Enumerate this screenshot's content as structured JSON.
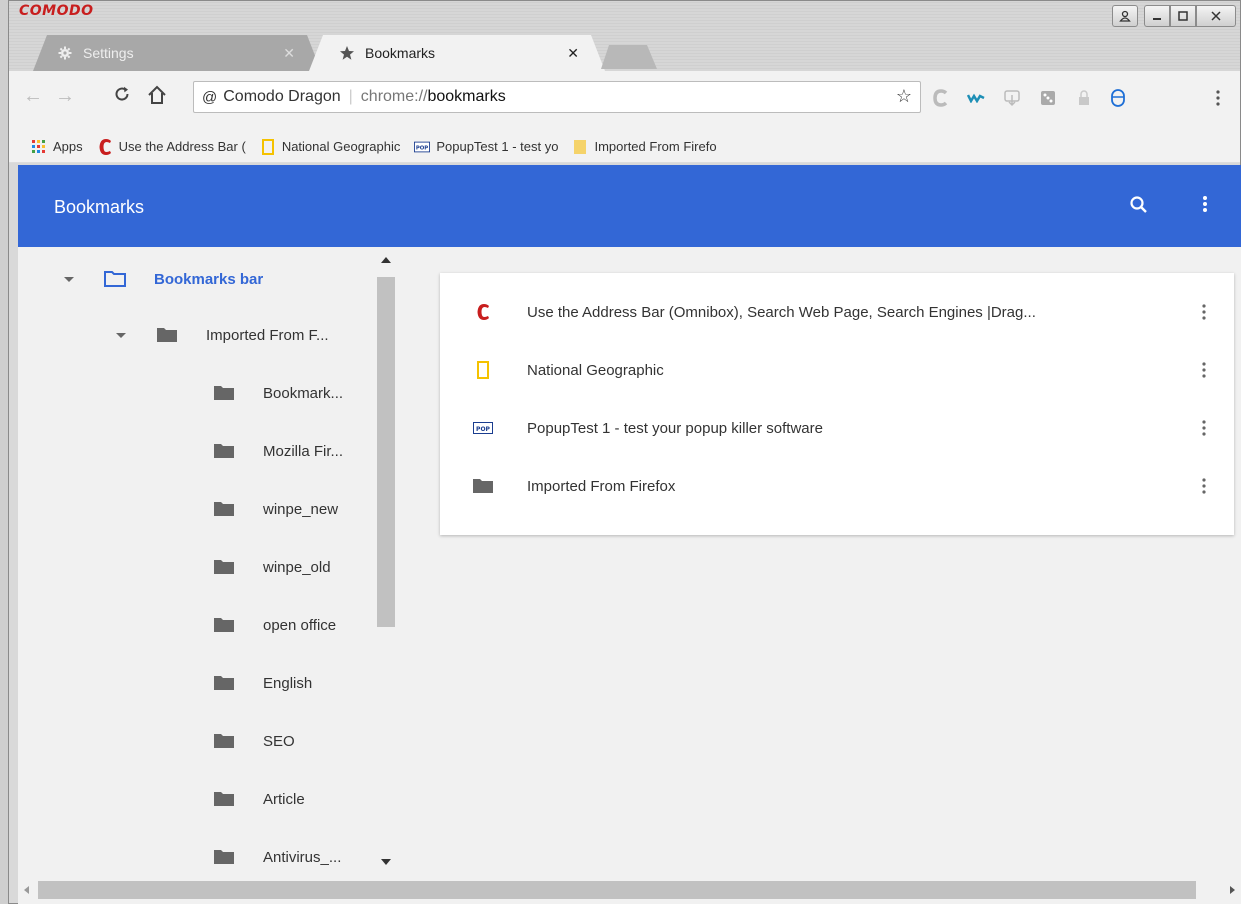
{
  "brand": "COMODO",
  "tabs": [
    {
      "label": "Settings",
      "icon": "gear-icon"
    },
    {
      "label": "Bookmarks",
      "icon": "star-icon"
    }
  ],
  "omnibox": {
    "site_label": "Comodo Dragon",
    "url_scheme": "chrome://",
    "url_host": "bookmarks"
  },
  "bookmarks_bar": {
    "items": [
      {
        "label": "Apps",
        "icon": "apps-grid-icon"
      },
      {
        "label": "Use the Address Bar (",
        "icon": "comodo-c-icon"
      },
      {
        "label": "National Geographic",
        "icon": "natgeo-icon"
      },
      {
        "label": "PopupTest 1 - test yo",
        "icon": "pop-icon"
      },
      {
        "label": "Imported From Firefo",
        "icon": "folder-yellow-icon"
      }
    ]
  },
  "header": {
    "title": "Bookmarks"
  },
  "tree": {
    "root": "Bookmarks bar",
    "child": "Imported From F...",
    "folders": [
      "Bookmark...",
      "Mozilla Fir...",
      "winpe_new",
      "winpe_old",
      "open office",
      "English",
      "SEO",
      "Article",
      "Antivirus_..."
    ]
  },
  "list": [
    {
      "title": "Use the Address Bar (Omnibox), Search Web Page, Search Engines |Drag...",
      "icon": "comodo-c-icon"
    },
    {
      "title": "National Geographic",
      "icon": "natgeo-icon"
    },
    {
      "title": "PopupTest 1 - test your popup killer software",
      "icon": "pop-icon"
    },
    {
      "title": "Imported From Firefox",
      "icon": "folder-icon"
    }
  ],
  "colors": {
    "accent": "#3367d6",
    "comodo_red": "#c81e1e",
    "natgeo_yellow": "#f5c200"
  }
}
